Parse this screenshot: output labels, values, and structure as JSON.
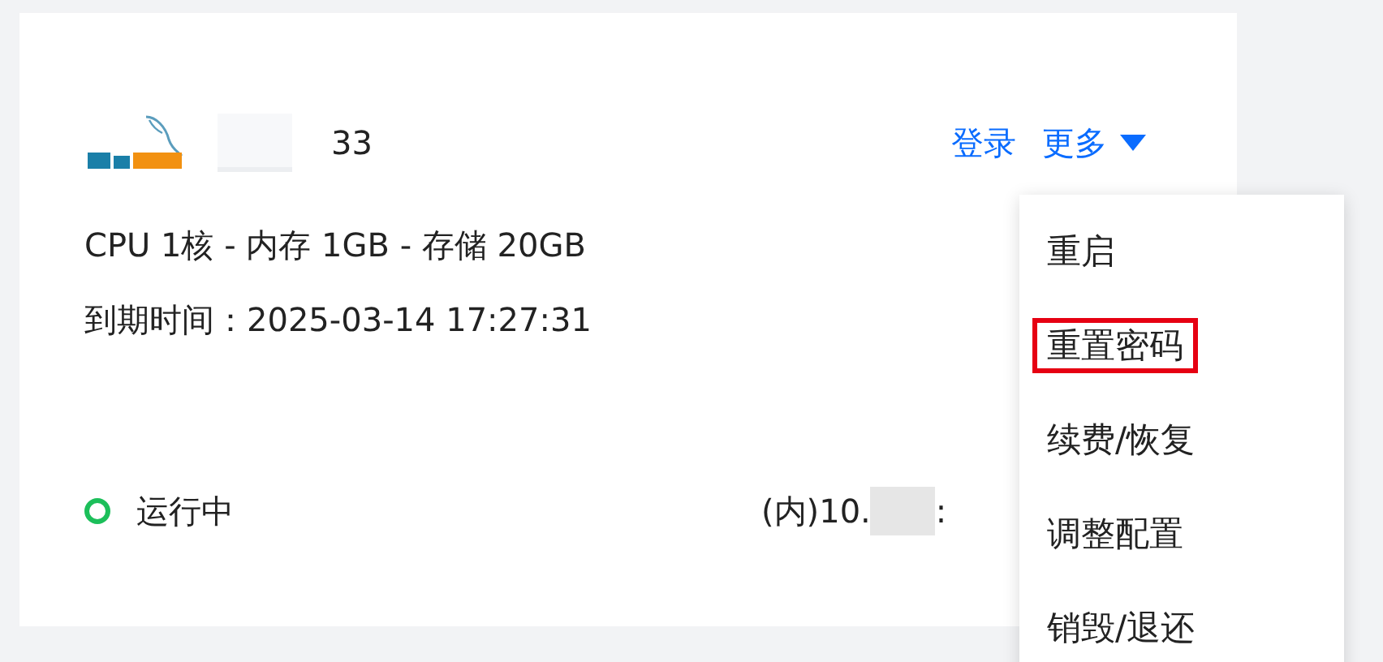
{
  "instance": {
    "name_tail": "33",
    "actions": [
      {
        "label": "登录",
        "kind": "link"
      },
      {
        "label": "更多",
        "kind": "dropdown"
      }
    ],
    "specs": "CPU 1核 - 内存 1GB - 存储 20GB",
    "expiry": "到期时间：2025-03-14 17:27:31",
    "status": {
      "label": "运行中",
      "color": "#1cbf5a"
    },
    "ip_start": "(内)10.",
    "ip_end": ":"
  },
  "menu": [
    {
      "label": "重启",
      "highlighted": false
    },
    {
      "label": "重置密码",
      "highlighted": true
    },
    {
      "label": "续费/恢复",
      "highlighted": false
    },
    {
      "label": "调整配置",
      "highlighted": false
    },
    {
      "label": "销毁/退还",
      "highlighted": false
    }
  ]
}
